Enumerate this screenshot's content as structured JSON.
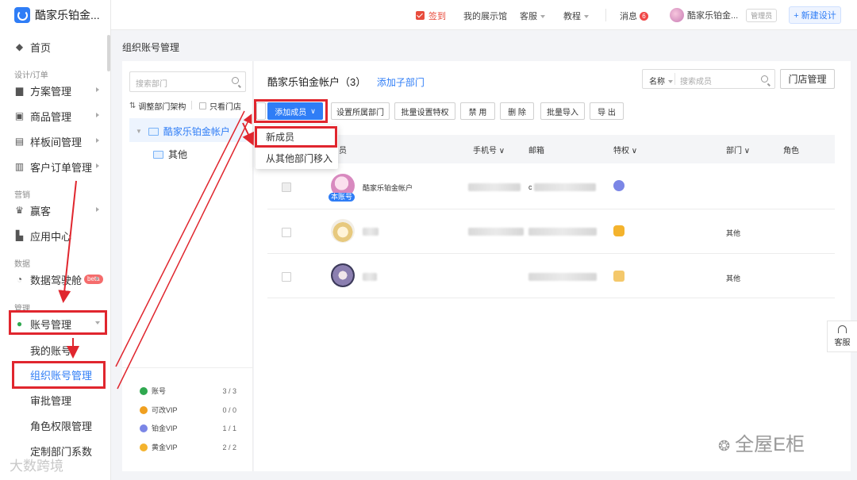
{
  "app": {
    "name": "酷家乐铂金..."
  },
  "sidebar": {
    "home": "首页",
    "group_design": "设计/订单",
    "scheme": "方案管理",
    "goods": "商品管理",
    "showroom": "样板间管理",
    "orders": "客户订单管理",
    "group_marketing": "营销",
    "yingke": "赢客",
    "apps": "应用中心",
    "group_data": "数据",
    "cockpit": "数据驾驶舱",
    "beta": "beta",
    "group_manage": "管理",
    "account_mgmt": "账号管理",
    "my_account": "我的账号",
    "org_account_mgmt": "组织账号管理",
    "approval": "审批管理",
    "role_perm": "角色权限管理",
    "custom_dept": "定制部门系数",
    "watermark": "大数跨境"
  },
  "topbar": {
    "checkin": "签到",
    "showroom": "我的展示馆",
    "service": "客服",
    "tutorial": "教程",
    "messages": "消息",
    "message_count": "6",
    "user": "酷家乐铂金...",
    "role": "管理员",
    "new_design": "+ 新建设计"
  },
  "page": {
    "title": "组织账号管理"
  },
  "tree": {
    "search_placeholder": "搜索部门",
    "adjust_structure": "调整部门架构",
    "only_stores": "只看门店",
    "root": "酷家乐铂金帐户",
    "child": "其他",
    "stats": [
      {
        "label": "账号",
        "value": "3 / 3",
        "color": "#2fa84f"
      },
      {
        "label": "可改VIP",
        "value": "0 / 0",
        "color": "#f0a020"
      },
      {
        "label": "铂金VIP",
        "value": "1 / 1",
        "color": "#7b86e6"
      },
      {
        "label": "黄金VIP",
        "value": "2 / 2",
        "color": "#f4b32d"
      }
    ]
  },
  "main": {
    "account_title": "酷家乐铂金帐户",
    "account_count": "（3）",
    "add_sub_dept": "添加子部门",
    "filter_label": "名称",
    "search_placeholder": "搜索成员",
    "store_mgmt": "门店管理",
    "toolbar": {
      "add_member": "添加成员",
      "set_dept": "设置所属部门",
      "batch_priv": "批量设置特权",
      "disable": "禁 用",
      "delete": "删 除",
      "batch_import": "批量导入",
      "export": "导 出"
    },
    "dropdown": {
      "new_member": "新成员",
      "move_from_dept": "从其他部门移入"
    },
    "columns": {
      "member": "员",
      "phone": "手机号",
      "email": "邮箱",
      "privilege": "特权",
      "dept": "部门",
      "role": "角色"
    },
    "rows": [
      {
        "name": "酷家乐铂金帐户",
        "own_tag": "本账号",
        "email_prefix": "c",
        "dept": "",
        "priv_color": "#7b86e6"
      },
      {
        "name": "",
        "own_tag": "",
        "email_prefix": "",
        "dept": "其他",
        "priv_color": "#f4b32d"
      },
      {
        "name": "",
        "own_tag": "",
        "email_prefix": "",
        "dept": "其他",
        "priv_color": "#f4c86b"
      }
    ]
  },
  "float_service": "客服",
  "watermark_right": "全屋E柜"
}
